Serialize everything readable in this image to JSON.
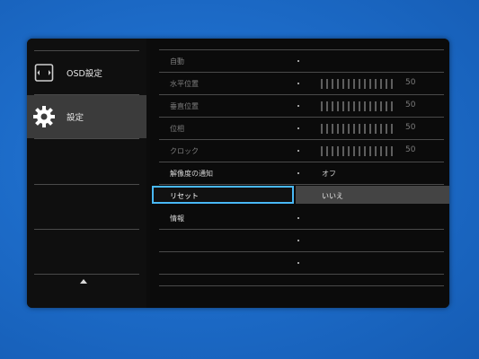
{
  "sidebar": {
    "items": [
      {
        "label": "OSD設定",
        "icon": "monitor-icon",
        "selected": false
      },
      {
        "label": "設定",
        "icon": "gear-icon",
        "selected": true
      }
    ],
    "scroll_up_icon": "triangle-up-icon"
  },
  "menu": {
    "rows": [
      {
        "label": "自動",
        "value": "",
        "slider": false
      },
      {
        "label": "水平位置",
        "value": "50",
        "slider": true,
        "level": 0.5
      },
      {
        "label": "垂直位置",
        "value": "50",
        "slider": true,
        "level": 0.5
      },
      {
        "label": "位相",
        "value": "50",
        "slider": true,
        "level": 0.5
      },
      {
        "label": "クロック",
        "value": "50",
        "slider": true,
        "level": 0.5
      },
      {
        "label": "解像度の通知",
        "value": "オフ",
        "slider": false
      },
      {
        "label": "リセット",
        "value": "いいえ",
        "slider": false,
        "selected": true
      },
      {
        "label": "情報",
        "value": "",
        "slider": false
      },
      {
        "label": "",
        "value": "",
        "slider": false
      },
      {
        "label": "",
        "value": "",
        "slider": false
      }
    ]
  },
  "colors": {
    "highlight_border": "#49b8f5",
    "selected_bg": "#3b3b3b",
    "panel_bg": "#0c0c0c",
    "screen_bg": "#1d6cc9"
  }
}
